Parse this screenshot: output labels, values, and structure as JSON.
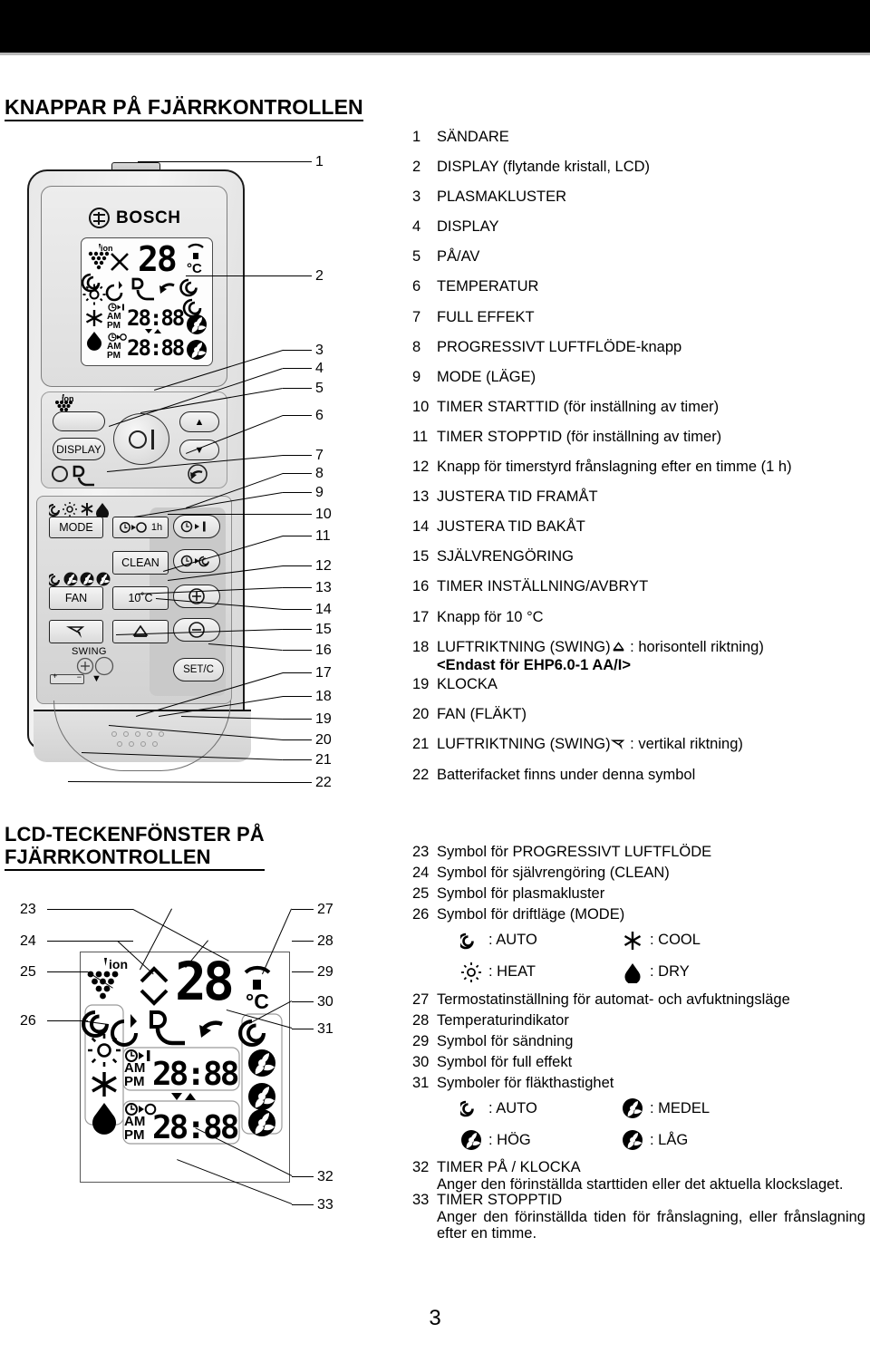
{
  "page": {
    "number": "3",
    "header_band_color": "#000000"
  },
  "section1": {
    "title": "KNAPPAR PÅ FJÄRRKONTROLLEN",
    "figure": {
      "brand": "BOSCH",
      "lcd": {
        "ion_label": "ion",
        "temp_value": "28",
        "unit": "°C",
        "timer_on_value": "28:88",
        "timer_off_value": "28:88",
        "am": "AM",
        "pm": "PM"
      },
      "buttons": [
        {
          "name": "display-button",
          "label": "DISPLAY"
        },
        {
          "name": "power-button",
          "label": ""
        },
        {
          "name": "temp-up-button",
          "label": "▲"
        },
        {
          "name": "temp-down-button",
          "label": "▼"
        },
        {
          "name": "mode-button",
          "label": "MODE"
        },
        {
          "name": "one-hour-timer-button",
          "label": "1h"
        },
        {
          "name": "timer-on-button",
          "label": ""
        },
        {
          "name": "clean-button",
          "label": "CLEAN"
        },
        {
          "name": "timer-off-button",
          "label": ""
        },
        {
          "name": "fan-button",
          "label": "FAN"
        },
        {
          "name": "ten-degree-button",
          "label": "10˚C"
        },
        {
          "name": "plus-button",
          "label": "+"
        },
        {
          "name": "minus-button",
          "label": "−"
        },
        {
          "name": "swing-vertical-button",
          "label": ""
        },
        {
          "name": "swing-horizontal-button",
          "label": ""
        },
        {
          "name": "swing-label",
          "label": "SWING"
        },
        {
          "name": "set-cancel-button",
          "label": "SET/C"
        }
      ]
    },
    "callouts": [
      "1",
      "2",
      "3",
      "4",
      "5",
      "6",
      "7",
      "8",
      "9",
      "10",
      "11",
      "12",
      "13",
      "14",
      "15",
      "16",
      "17",
      "18",
      "19",
      "20",
      "21",
      "22"
    ],
    "items": [
      {
        "num": "1",
        "text": "SÄNDARE"
      },
      {
        "num": "2",
        "text": "DISPLAY (flytande kristall, LCD)"
      },
      {
        "num": "3",
        "text": "PLASMAKLUSTER"
      },
      {
        "num": "4",
        "text": "DISPLAY"
      },
      {
        "num": "5",
        "text": "PÅ/AV"
      },
      {
        "num": "6",
        "text": "TEMPERATUR"
      },
      {
        "num": "7",
        "text": "FULL EFFEKT"
      },
      {
        "num": "8",
        "text": "PROGRESSIVT LUFTFLÖDE-knapp"
      },
      {
        "num": "9",
        "text": "MODE (LÄGE)"
      },
      {
        "num": "10",
        "text": "TIMER STARTTID (för inställning av timer)"
      },
      {
        "num": "11",
        "text": "TIMER STOPPTID (för inställning av timer)"
      },
      {
        "num": "12",
        "text": "Knapp för timerstyrd frånslagning efter en timme (1 h)"
      },
      {
        "num": "13",
        "text": "JUSTERA TID FRAMÅT"
      },
      {
        "num": "14",
        "text": "JUSTERA TID BAKÅT"
      },
      {
        "num": "15",
        "text": "SJÄLVRENGÖRING"
      },
      {
        "num": "16",
        "text": "TIMER INSTÄLLNING/AVBRYT"
      },
      {
        "num": "17",
        "text": "Knapp för 10 °C"
      },
      {
        "num": "18",
        "text_before": "LUFTRIKTNING (SWING)",
        "icon": "swing-horizontal-icon",
        "text_after": " : horisontell riktning)",
        "note": "<Endast för EHP6.0-1 AA/I>"
      },
      {
        "num": "19",
        "text": "KLOCKA"
      },
      {
        "num": "20",
        "text": "FAN (FLÄKT)"
      },
      {
        "num": "21",
        "text_before": "LUFTRIKTNING (SWING)",
        "icon": "swing-vertical-icon",
        "text_after": " : vertikal riktning)"
      },
      {
        "num": "22",
        "text": "Batterifacket finns under denna symbol"
      }
    ]
  },
  "section2": {
    "title": "LCD-TECKENFÖNSTER PÅ\nFJÄRRKONTROLLEN",
    "callouts_left": [
      "23",
      "24",
      "25",
      "26"
    ],
    "callouts_right": [
      "27",
      "28",
      "29",
      "30",
      "31",
      "32",
      "33"
    ],
    "figure": {
      "ion_label": "ion",
      "temp_value": "28",
      "unit": "°C",
      "timer_on_value": "28:88",
      "timer_off_value": "28:88",
      "am": "AM",
      "pm": "PM"
    },
    "items": [
      {
        "num": "23",
        "text": "Symbol för PROGRESSIVT LUFTFLÖDE"
      },
      {
        "num": "24",
        "text": "Symbol för självrengöring (CLEAN)"
      },
      {
        "num": "25",
        "text": "Symbol för plasmakluster"
      },
      {
        "num": "26",
        "text": "Symbol för driftläge (MODE)"
      },
      {
        "num": "27",
        "text": "Termostatinställning för automat- och avfuktningsläge"
      },
      {
        "num": "28",
        "text": "Temperaturindikator"
      },
      {
        "num": "29",
        "text": "Symbol för sändning"
      },
      {
        "num": "30",
        "text": "Symbol för full effekt"
      },
      {
        "num": "31",
        "text": "Symboler för fläkthastighet"
      },
      {
        "num": "32",
        "text": "TIMER PÅ / KLOCKA",
        "detail": "Anger den förinställda starttiden eller det aktuella klockslaget."
      },
      {
        "num": "33",
        "text": "TIMER STOPPTID",
        "detail": "Anger den förinställda tiden för frånslagning, eller frånslagning efter en timme."
      }
    ],
    "mode_symbols": [
      {
        "icon": "auto-mode-icon",
        "label": ": AUTO"
      },
      {
        "icon": "cool-mode-icon",
        "label": ": COOL"
      },
      {
        "icon": "heat-mode-icon",
        "label": ": HEAT"
      },
      {
        "icon": "dry-mode-icon",
        "label": ": DRY"
      }
    ],
    "fan_symbols": [
      {
        "icon": "fan-auto-icon",
        "label": ": AUTO"
      },
      {
        "icon": "fan-medium-icon",
        "label": ": MEDEL"
      },
      {
        "icon": "fan-high-icon",
        "label": ": HÖG"
      },
      {
        "icon": "fan-low-icon",
        "label": ": LÅG"
      }
    ]
  }
}
